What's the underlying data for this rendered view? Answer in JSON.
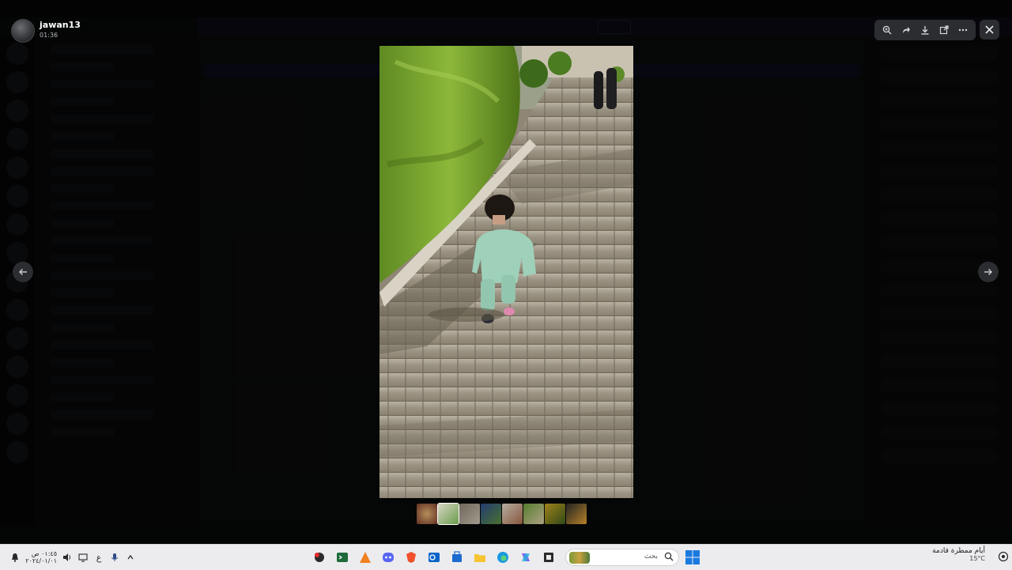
{
  "background_app": {
    "app_name": "",
    "notice_text": "",
    "notice_button": ""
  },
  "viewer": {
    "uploader_name": "jawan13",
    "uploader_time": "01:36",
    "toolbar_icons": [
      "zoom-icon",
      "forward-icon",
      "download-icon",
      "open-external-icon",
      "more-icon"
    ],
    "close_icon": "close-icon",
    "prev_icon": "arrow-left-icon",
    "next_icon": "arrow-right-icon",
    "thumbnail_count": 8,
    "selected_thumbnail": 2
  },
  "taskbar": {
    "clock_time": "٠١:٤٥ ص",
    "clock_date": "٢٠٢٤/٠١/٠١",
    "lang_indicator": "ع",
    "search_placeholder": "بحث",
    "weather_title": "أيام ممطرة قادمة",
    "weather_temp": "15°C",
    "app_icons": [
      "app-red-icon",
      "terminal-icon",
      "orange-app-icon",
      "discord-icon",
      "brave-icon",
      "outlook-icon",
      "store-icon",
      "folder-icon",
      "edge-icon",
      "copilot-icon",
      "media-icon"
    ]
  },
  "colors": {
    "overlay": "#000000",
    "toolbar_bg": "#2b2d31",
    "taskbar_bg": "#ececef"
  }
}
